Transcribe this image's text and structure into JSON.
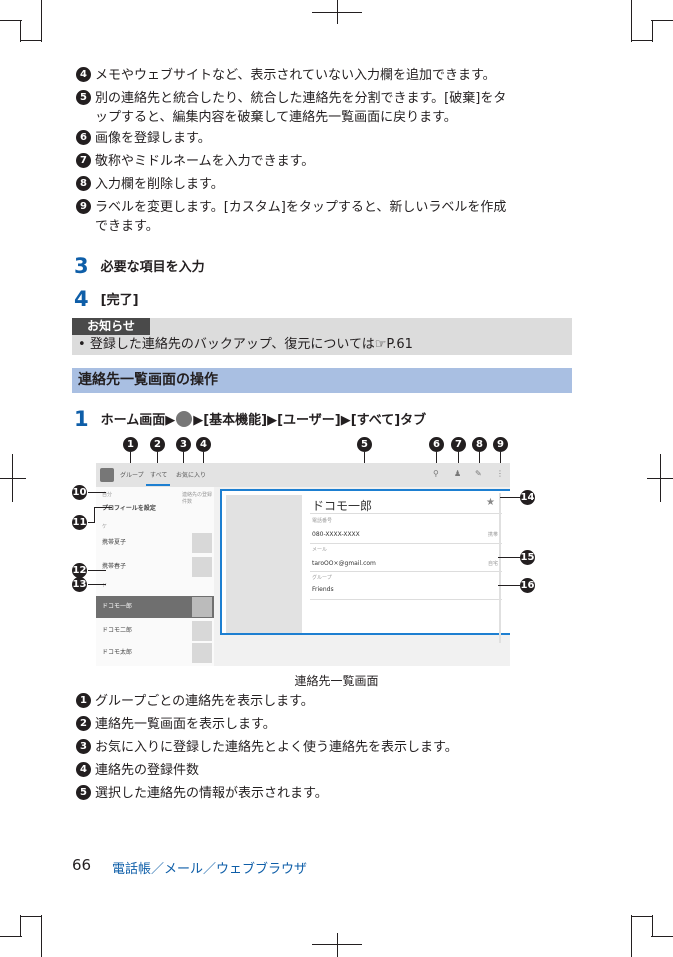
{
  "list_top": [
    {
      "num": "4",
      "text": "メモやウェブサイトなど、表示されていない入力欄を追加できます。"
    },
    {
      "num": "5",
      "text": "別の連絡先と統合したり、統合した連絡先を分割できます。[破棄]をタ",
      "cont": "ップすると、編集内容を破棄して連絡先一覧画面に戻ります。"
    },
    {
      "num": "6",
      "text": "画像を登録します。"
    },
    {
      "num": "7",
      "text": "敬称やミドルネームを入力できます。"
    },
    {
      "num": "8",
      "text": "入力欄を削除します。"
    },
    {
      "num": "9",
      "text": "ラベルを変更します。[カスタム]をタップすると、新しいラベルを作成",
      "cont": "できます。"
    }
  ],
  "steps": [
    {
      "num": "3",
      "text": "必要な項目を入力"
    },
    {
      "num": "4",
      "text": "[完了]"
    }
  ],
  "note": {
    "tag": "お知らせ",
    "text": "登録した連絡先のバックアップ、復元については☞P.61"
  },
  "section_title": "連絡先一覧画面の操作",
  "step1": {
    "num": "1",
    "text_a": "ホーム画面▶",
    "text_b": "▶[基本機能]▶[ユーザー]▶[すべて]タブ"
  },
  "callouts": [
    "1",
    "2",
    "3",
    "4",
    "5",
    "6",
    "7",
    "8",
    "9",
    "10",
    "11",
    "12",
    "13",
    "14",
    "15",
    "16"
  ],
  "screen": {
    "tabs": [
      "グループ",
      "すべて",
      "お気に入り"
    ],
    "count_label": "連絡先の登録件数",
    "me_label": "自分",
    "profile": "プロフィールを設定",
    "index_a": "ケ",
    "index_b": "ド",
    "contacts": [
      "携帯夏子",
      "携帯春子",
      "ドコモ一郎",
      "ドコモ二郎",
      "ドコモ太郎"
    ],
    "name": "ドコモ一郎",
    "phone_label": "電話番号",
    "phone": "080-XXXX-XXXX",
    "phone_type": "携帯",
    "mail_label": "メール",
    "mail": "taroOO×@gmail.com",
    "mail_type": "自宅",
    "group_label": "グループ",
    "group": "Friends"
  },
  "caption": "連絡先一覧画面",
  "list_bottom": [
    {
      "num": "1",
      "text": "グループごとの連絡先を表示します。"
    },
    {
      "num": "2",
      "text": "連絡先一覧画面を表示します。"
    },
    {
      "num": "3",
      "text": "お気に入りに登録した連絡先とよく使う連絡先を表示します。"
    },
    {
      "num": "4",
      "text": "連絡先の登録件数"
    },
    {
      "num": "5",
      "text": "選択した連絡先の情報が表示されます。"
    }
  ],
  "footer": {
    "page": "66",
    "title": "電話帳／メール／ウェブブラウザ"
  }
}
